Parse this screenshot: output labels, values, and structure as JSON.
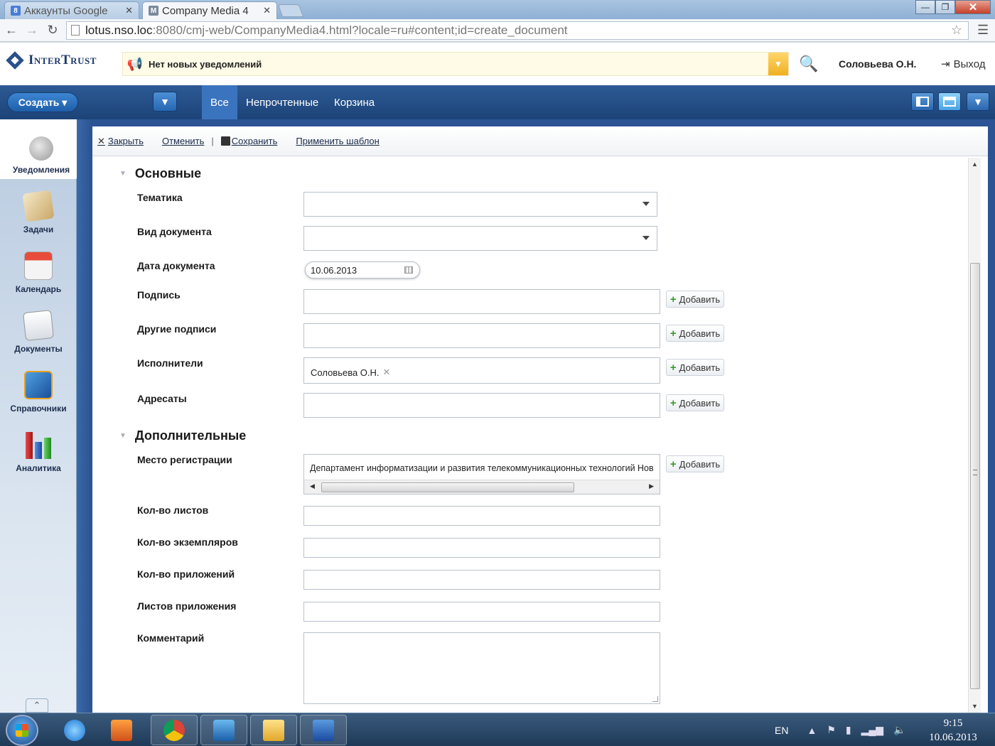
{
  "browser": {
    "tabs": [
      {
        "title": "Аккаунты Google",
        "favicon": "8",
        "favicon_color": "#4a7dd4"
      },
      {
        "title": "Company Media 4",
        "favicon": "M",
        "favicon_color": "#7a8a9a"
      }
    ],
    "url_host": "lotus.nso.loc",
    "url_path": ":8080/cmj-web/CompanyMedia4.html?locale=ru#content;id=create_document",
    "window_controls": {
      "minimize": "—",
      "maximize": "❐",
      "close": "✕"
    }
  },
  "header": {
    "logo_text": "InterTrust",
    "notification_text": "Нет новых уведомлений",
    "user_name": "Соловьева О.Н.",
    "logout_label": "Выход"
  },
  "toolbar": {
    "create_label": "Создать ▾",
    "tabs": [
      "Все",
      "Непрочтенные",
      "Корзина"
    ],
    "active_tab": "Все"
  },
  "sidebar": {
    "items": [
      {
        "label": "Уведомления",
        "icon": "megaphone-icon"
      },
      {
        "label": "Задачи",
        "icon": "tasks-icon"
      },
      {
        "label": "Календарь",
        "icon": "calendar-icon"
      },
      {
        "label": "Документы",
        "icon": "documents-icon"
      },
      {
        "label": "Справочники",
        "icon": "book-icon"
      },
      {
        "label": "Аналитика",
        "icon": "chart-icon"
      }
    ],
    "active": "Уведомления"
  },
  "actions": {
    "close": "Закрыть",
    "cancel": "Отменить",
    "save": "Сохранить",
    "apply_template": "Применить шаблон"
  },
  "form": {
    "section_main": "Основные",
    "section_extra": "Дополнительные",
    "add_label": "Добавить",
    "fields": {
      "topic": {
        "label": "Тематика",
        "value": ""
      },
      "doc_type": {
        "label": "Вид документа",
        "value": ""
      },
      "doc_date": {
        "label": "Дата документа",
        "value": "10.06.2013"
      },
      "signature": {
        "label": "Подпись",
        "value": ""
      },
      "other_signatures": {
        "label": "Другие подписи",
        "value": ""
      },
      "executors": {
        "label": "Исполнители",
        "value": "Соловьева О.Н."
      },
      "addressees": {
        "label": "Адресаты",
        "value": ""
      },
      "reg_place": {
        "label": "Место регистрации",
        "value": "Департамент информатизации и развития телекоммуникационных технологий Нов"
      },
      "sheets": {
        "label": "Кол-во листов",
        "value": ""
      },
      "copies": {
        "label": "Кол-во экземпляров",
        "value": ""
      },
      "attachments": {
        "label": "Кол-во приложений",
        "value": ""
      },
      "attachment_sheets": {
        "label": "Листов приложения",
        "value": ""
      },
      "comment": {
        "label": "Комментарий",
        "value": ""
      }
    }
  },
  "taskbar": {
    "language": "EN",
    "time": "9:15",
    "date": "10.06.2013",
    "apps": [
      "internet-explorer-icon",
      "media-player-icon",
      "chrome-icon",
      "lync-icon",
      "file-explorer-icon",
      "word-icon"
    ]
  }
}
